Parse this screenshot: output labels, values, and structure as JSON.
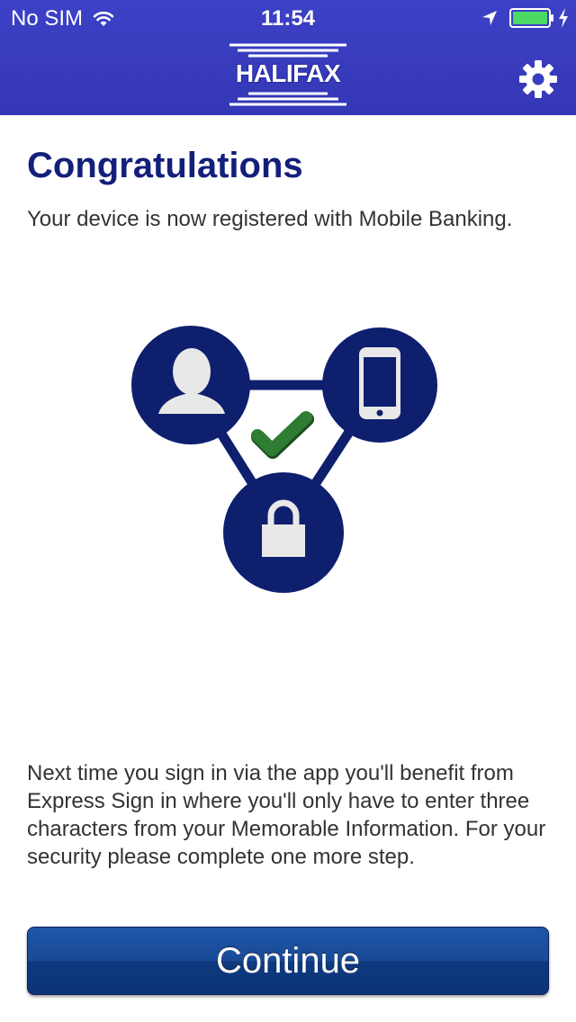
{
  "status_bar": {
    "carrier": "No SIM",
    "time": "11:54",
    "icons": [
      "wifi-icon",
      "location-arrow-icon",
      "battery-icon",
      "charging-bolt-icon"
    ]
  },
  "header": {
    "logo_text": "HALIFAX",
    "settings_icon": "gear-icon"
  },
  "main": {
    "title": "Congratulations",
    "intro": "Your device is now registered with Mobile Banking.",
    "diagram_icons": [
      "user-silhouette-icon",
      "smartphone-icon",
      "padlock-icon",
      "checkmark-icon"
    ],
    "info": "Next time you sign in via the app you'll benefit from Express Sign in where you'll only have to enter three characters from your Memorable Information. For your security please complete one more step.",
    "continue_label": "Continue"
  },
  "colors": {
    "header_bg": "#3b3fc1",
    "title": "#141f7b",
    "diagram_blue": "#0e1f6e",
    "check_green": "#2e7d32",
    "button_blue": "#1a4c98",
    "battery_green": "#4cd964"
  }
}
